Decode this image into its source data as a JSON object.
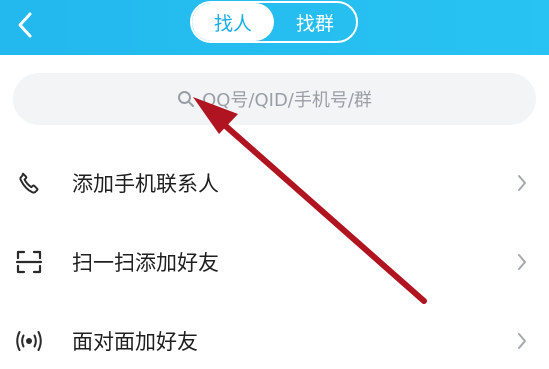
{
  "header": {
    "back_icon": "chevron-left-icon",
    "tabs": [
      {
        "label": "找人",
        "active": true
      },
      {
        "label": "找群",
        "active": false
      }
    ]
  },
  "search": {
    "icon": "search-icon",
    "placeholder": "QQ号/QID/手机号/群"
  },
  "menu": {
    "items": [
      {
        "icon": "phone-icon",
        "label": "添加手机联系人"
      },
      {
        "icon": "scan-icon",
        "label": "扫一扫添加好友"
      },
      {
        "icon": "broadcast-icon",
        "label": "面对面加好友"
      }
    ]
  },
  "colors": {
    "header": "#23b8ee",
    "active_tab_text": "#19aee6",
    "annotation_arrow": "#b01420"
  }
}
